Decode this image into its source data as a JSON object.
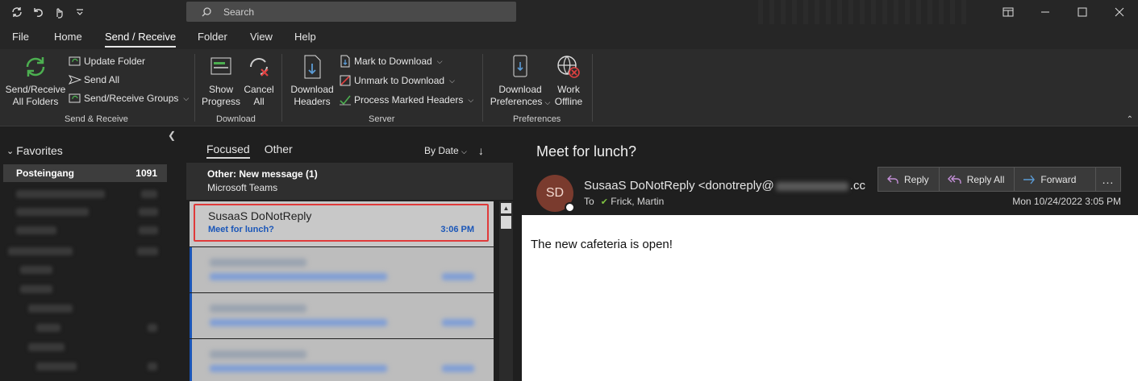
{
  "titlebar": {
    "search_placeholder": "Search"
  },
  "menu": {
    "tabs": [
      "File",
      "Home",
      "Send / Receive",
      "Folder",
      "View",
      "Help"
    ],
    "active": "Send / Receive"
  },
  "ribbon": {
    "send_receive_all_line1": "Send/Receive",
    "send_receive_all_line2": "All Folders",
    "update_folder": "Update Folder",
    "send_all": "Send All",
    "send_receive_groups": "Send/Receive Groups",
    "group_send_receive": "Send & Receive",
    "show_progress_line1": "Show",
    "show_progress_line2": "Progress",
    "cancel_all_line1": "Cancel",
    "cancel_all_line2": "All",
    "group_download": "Download",
    "download_headers_line1": "Download",
    "download_headers_line2": "Headers",
    "mark_to_download": "Mark to Download",
    "unmark_to_download": "Unmark to Download",
    "process_marked_headers": "Process Marked Headers",
    "group_server": "Server",
    "download_preferences_line1": "Download",
    "download_preferences_line2": "Preferences",
    "work_offline_line1": "Work",
    "work_offline_line2": "Offline",
    "group_preferences": "Preferences"
  },
  "folders": {
    "favorites_label": "Favorites",
    "inbox_name": "Posteingang",
    "inbox_count": "1091"
  },
  "message_list": {
    "tab_focused": "Focused",
    "tab_other": "Other",
    "sort_label": "By Date",
    "group_header_title": "Other: New message (1)",
    "group_header_sub": "Microsoft Teams",
    "selected_sender": "SusaaS DoNotReply",
    "selected_subject": "Meet for lunch?",
    "selected_time": "3:06 PM"
  },
  "reading_pane": {
    "subject": "Meet for lunch?",
    "avatar_initials": "SD",
    "from_name": "SusaaS DoNotReply <donotreply@",
    "from_suffix": ".cc",
    "to_label": "To",
    "to_name": "Frick, Martin",
    "date": "Mon 10/24/2022 3:05 PM",
    "reply": "Reply",
    "reply_all": "Reply All",
    "forward": "Forward",
    "more": "...",
    "body_text": "The new cafeteria is open!"
  },
  "colors": {
    "accent_blue": "#1a56b8",
    "highlight_red": "#e03a3a",
    "avatar_bg": "#7a3b2e"
  }
}
